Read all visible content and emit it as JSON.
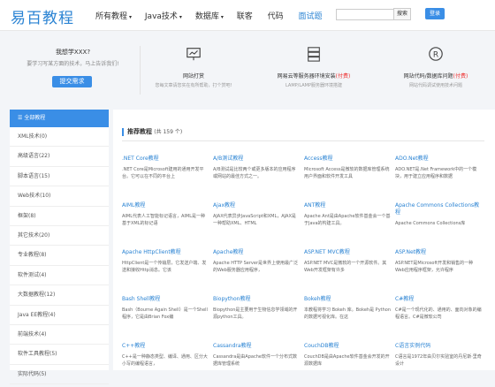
{
  "header": {
    "logo": "易百教程",
    "nav": [
      "所有教程",
      "Java技术",
      "数据库",
      "联客",
      "代码",
      "面试题"
    ],
    "active_index": 5,
    "search_button": "搜索",
    "login_button": "登录"
  },
  "promo": {
    "want_title": "我想学XXX?",
    "want_sub": "要学习写某方面的技术，马上告诉我们!",
    "ask_button": "提交需求",
    "features": [
      {
        "icon": "presentation-icon",
        "title": "网站打赏",
        "sub": "您每文章请您实在有所帮助，打个赏吧!",
        "highlight": ""
      },
      {
        "icon": "server-icon",
        "title": "网易云等服务器环境安装",
        "highlight": "(付费)",
        "sub": "LAMP/LAMP服务器环境搭建"
      },
      {
        "icon": "registered-icon",
        "title": "网站代码/数据库问题",
        "highlight": "(付费)",
        "sub": "网站代码调试使用技术问题"
      }
    ]
  },
  "sidebar": {
    "header": "全部教程",
    "items": [
      "XML技术(0)",
      "高级语言(22)",
      "脚本语言(15)",
      "Web技术(10)",
      "框架(8)",
      "其它技术(20)",
      "专业教程(8)",
      "软件测试(4)",
      "大数据教程(12)",
      "Java EE教程(4)",
      "前端技术(4)",
      "软件工具教程(5)",
      "实际代码(5)"
    ]
  },
  "main": {
    "title": "推荐教程",
    "count": "(共 159 个)",
    "cards": [
      {
        "title": ".NET Core教程",
        "desc": ".NET Core是Microsoft建用的通用开发平台。它可以在不同的平台上"
      },
      {
        "title": "A/B测试教程",
        "desc": "A/B测试是比较两个或更多版本的应用程序或网站的最佳方式之一。"
      },
      {
        "title": "Access教程",
        "desc": "Microsoft Access是微软的数据库管理系统用户界面和软件开发工具"
      },
      {
        "title": "ADO.Net教程",
        "desc": "ADO.NET是.Net Framework中的一个模块，用于建立应用程序和数据"
      },
      {
        "title": "AIML教程",
        "desc": "AIML代表人工智能标记语言，AIML是一种基于XML的标记语"
      },
      {
        "title": "Ajax教程",
        "desc": "AJAX代表异步JavaScript和XML，AJAX是一种帮助XML、HTML"
      },
      {
        "title": "ANT教程",
        "desc": "Apache Ant是由Apache软件基金会一个基于Java的构建工具。"
      },
      {
        "title": "Apache Commons Collections教程",
        "desc": "Apache Commons Collections库"
      },
      {
        "title": "Apache HttpClient教程",
        "desc": "HttpClient是一个传输层，它发送户端、发送和接收Http消息。它该"
      },
      {
        "title": "Apache教程",
        "desc": "Apache HTTP Server是世界上使用最广泛的Web服务器应用程序，"
      },
      {
        "title": "ASP.NET MVC教程",
        "desc": "ASP.NET MVC是微软的一个开源软件。其Web开发框架有许多"
      },
      {
        "title": "ASP.Net教程",
        "desc": "ASP.NET是Microsoft开发和销售的一种Web应用程序框架，允许程序"
      },
      {
        "title": "Bash Shell教程",
        "desc": "Bash（Bourne Again Shell）是一个Shell程序，它是由Brian Fox编"
      },
      {
        "title": "Biopython教程",
        "desc": "Biopython是主要用于生物信息学领域的开源python工具。"
      },
      {
        "title": "Bokeh教程",
        "desc": "本教程将学习 Bokeh 库。Bokeh是 Python 的数据可视化库。在这"
      },
      {
        "title": "C#教程",
        "desc": "C#是一个现代化的、通用的、面向对象的编程语言。C#是微软公司"
      },
      {
        "title": "C++教程",
        "desc": "C++是一种静态类型、编译、通用、区分大小写的编程语言，"
      },
      {
        "title": "Cassandra教程",
        "desc": "Cassandra是由Apache软件一个分布式数据库管理系统"
      },
      {
        "title": "CouchDB教程",
        "desc": "CouchDB是由Apache软件基金会开发的开源数据库"
      },
      {
        "title": "C语言实例代码",
        "desc": "C语言是1972年由贝尔实验室的丹尼斯·里奇设计"
      }
    ]
  }
}
